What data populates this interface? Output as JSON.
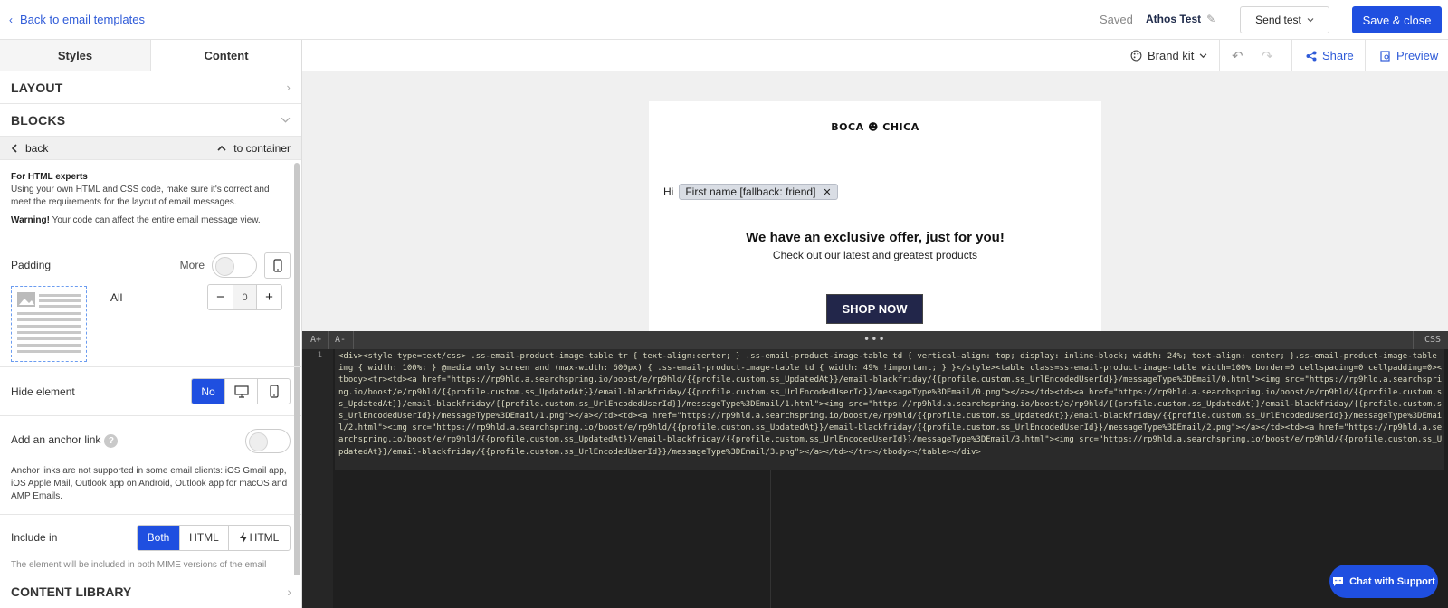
{
  "header": {
    "back_label": "Back to email templates",
    "saved_label": "Saved",
    "title": "Athos Test",
    "send_test_label": "Send test",
    "save_close_label": "Save & close"
  },
  "left_panel": {
    "tabs": [
      "Styles",
      "Content"
    ],
    "layout_label": "LAYOUT",
    "blocks_label": "BLOCKS",
    "back_label": "back",
    "container_label": "to container",
    "info_heading": "For HTML experts",
    "info_text": "Using your own HTML and CSS code, make sure it's correct and meet the requirements for the layout of email messages.",
    "warning_label": "Warning!",
    "warning_text": " Your code can affect the entire email message view.",
    "padding_label": "Padding",
    "more_label": "More",
    "all_label": "All",
    "padding_value": "0",
    "hide_label": "Hide element",
    "hide_no": "No",
    "anchor_label": "Add an anchor link",
    "anchor_note": "Anchor links are not supported in some email clients: iOS Gmail app, iOS Apple Mail, Outlook app on Android, Outlook app for macOS and AMP Emails.",
    "include_label": "Include in",
    "include_both": "Both",
    "include_html": "HTML",
    "include_amp": "HTML",
    "cutoff_text": "The element will be included in both MIME versions of the email",
    "content_library_label": "CONTENT LIBRARY"
  },
  "toolbar": {
    "brand_kit_label": "Brand kit",
    "share_label": "Share",
    "preview_label": "Preview"
  },
  "email": {
    "logo_text": "BOCA ☻ CHICA",
    "greeting": "Hi",
    "merge_tag": "First name [fallback: friend]",
    "headline": "We have an exclusive offer, just for you!",
    "subline": "Check out our latest and greatest products",
    "cta": "SHOP NOW"
  },
  "editor": {
    "font_up": "A+",
    "font_down": "A-",
    "dots": "•••",
    "css_label": "CSS",
    "line_number": "1",
    "code": "<div><style type=text/css> .ss-email-product-image-table tr { text-align:center; } .ss-email-product-image-table td { vertical-align: top; display: inline-block; width: 24%; text-align: center; }.ss-email-product-image-table img { width: 100%; } @media only screen and (max-width: 600px) { .ss-email-product-image-table td { width: 49% !important; } }</style><table class=ss-email-product-image-table width=100% border=0 cellspacing=0 cellpadding=0><tbody><tr><td><a href=\"https://rp9hld.a.searchspring.io/boost/e/rp9hld/{{profile.custom.ss_UpdatedAt}}/email-blackfriday/{{profile.custom.ss_UrlEncodedUserId}}/messageType%3DEmail/0.html\"><img src=\"https://rp9hld.a.searchspring.io/boost/e/rp9hld/{{profile.custom.ss_UpdatedAt}}/email-blackfriday/{{profile.custom.ss_UrlEncodedUserId}}/messageType%3DEmail/0.png\"></a></td><td><a href=\"https://rp9hld.a.searchspring.io/boost/e/rp9hld/{{profile.custom.ss_UpdatedAt}}/email-blackfriday/{{profile.custom.ss_UrlEncodedUserId}}/messageType%3DEmail/1.html\"><img src=\"https://rp9hld.a.searchspring.io/boost/e/rp9hld/{{profile.custom.ss_UpdatedAt}}/email-blackfriday/{{profile.custom.ss_UrlEncodedUserId}}/messageType%3DEmail/1.png\"></a></td><td><a href=\"https://rp9hld.a.searchspring.io/boost/e/rp9hld/{{profile.custom.ss_UpdatedAt}}/email-blackfriday/{{profile.custom.ss_UrlEncodedUserId}}/messageType%3DEmail/2.html\"><img src=\"https://rp9hld.a.searchspring.io/boost/e/rp9hld/{{profile.custom.ss_UpdatedAt}}/email-blackfriday/{{profile.custom.ss_UrlEncodedUserId}}/messageType%3DEmail/2.png\"></a></td><td><a href=\"https://rp9hld.a.searchspring.io/boost/e/rp9hld/{{profile.custom.ss_UpdatedAt}}/email-blackfriday/{{profile.custom.ss_UrlEncodedUserId}}/messageType%3DEmail/3.html\"><img src=\"https://rp9hld.a.searchspring.io/boost/e/rp9hld/{{profile.custom.ss_UpdatedAt}}/email-blackfriday/{{profile.custom.ss_UrlEncodedUserId}}/messageType%3DEmail/3.png\"></a></td></tr></tbody></table></div>"
  },
  "chat_label": "Chat with Support",
  "colors": {
    "accent": "#1f4fe0",
    "link": "#2f5bd8",
    "cta_bg": "#22264a",
    "editor_bg": "#1f1f1f"
  },
  "icons": [
    "chevron-left-icon",
    "pencil-icon",
    "chevron-down-icon",
    "chevron-right-icon",
    "chevron-up-icon",
    "mobile-icon",
    "desktop-icon",
    "minus-icon",
    "plus-icon",
    "help-icon",
    "bolt-icon",
    "palette-icon",
    "undo-icon",
    "redo-icon",
    "share-icon",
    "preview-icon",
    "close-icon",
    "chat-icon"
  ]
}
